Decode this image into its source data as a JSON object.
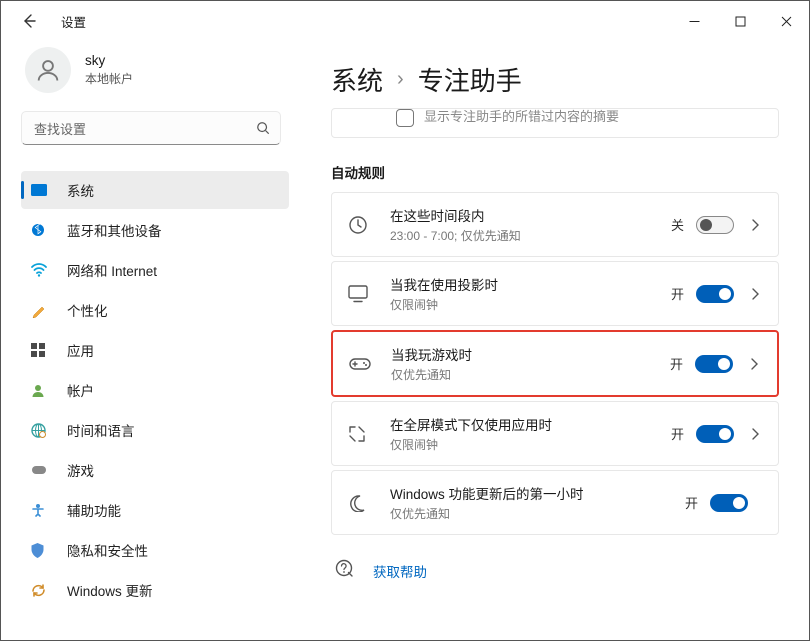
{
  "window": {
    "title": "设置"
  },
  "user": {
    "name": "sky",
    "account_type": "本地帐户"
  },
  "search": {
    "placeholder": "查找设置"
  },
  "nav": {
    "system": "系统",
    "bluetooth": "蓝牙和其他设备",
    "network": "网络和 Internet",
    "personalization": "个性化",
    "apps": "应用",
    "accounts": "帐户",
    "time_lang": "时间和语言",
    "gaming": "游戏",
    "accessibility": "辅助功能",
    "privacy": "隐私和安全性",
    "update": "Windows 更新"
  },
  "breadcrumb": {
    "parent": "系统",
    "current": "专注助手"
  },
  "partial": {
    "label": "显示专注助手的所错过内容的摘要"
  },
  "section": {
    "title": "自动规则"
  },
  "state_labels": {
    "on": "开",
    "off": "关"
  },
  "rules": {
    "hours": {
      "title": "在这些时间段内",
      "subtitle": "23:00 - 7:00; 仅优先通知",
      "state": "关",
      "on": false,
      "chev": true
    },
    "projecting": {
      "title": "当我在使用投影时",
      "subtitle": "仅限闹钟",
      "state": "开",
      "on": true,
      "chev": true
    },
    "gaming": {
      "title": "当我玩游戏时",
      "subtitle": "仅优先通知",
      "state": "开",
      "on": true,
      "chev": true
    },
    "fullscreen": {
      "title": "在全屏模式下仅使用应用时",
      "subtitle": "仅限闹钟",
      "state": "开",
      "on": true,
      "chev": true
    },
    "feature": {
      "title": "Windows 功能更新后的第一小时",
      "subtitle": "仅优先通知",
      "state": "开",
      "on": true,
      "chev": false
    }
  },
  "help": {
    "label": "获取帮助"
  }
}
